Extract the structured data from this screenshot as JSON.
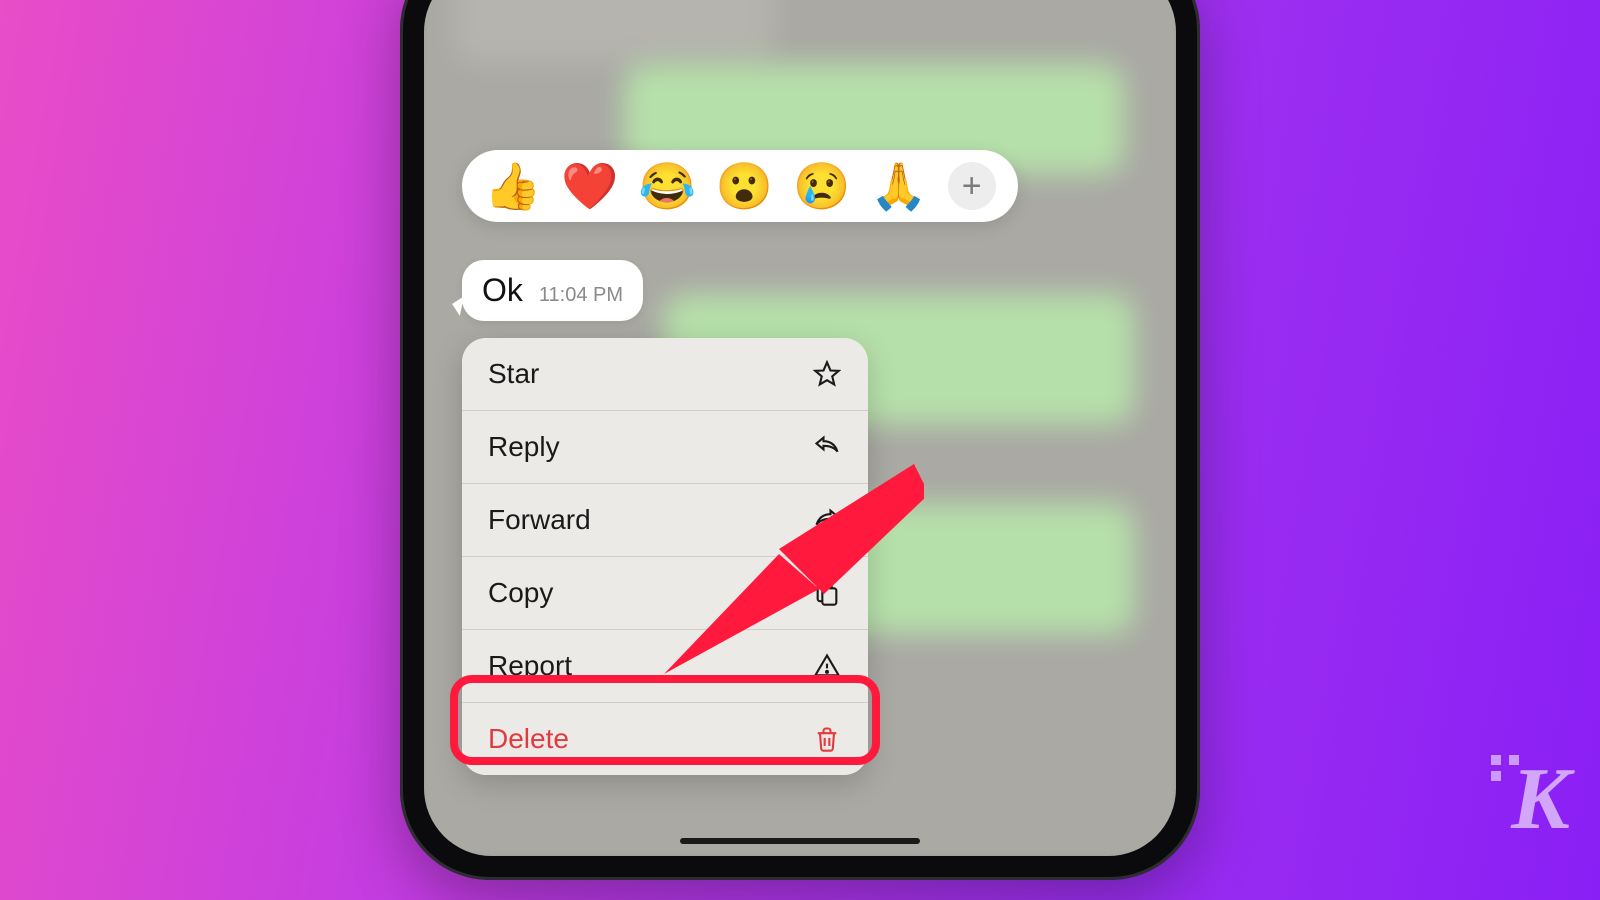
{
  "message": {
    "text": "Ok",
    "time": "11:04 PM"
  },
  "reactions": {
    "items": [
      "👍",
      "❤️",
      "😂",
      "😮",
      "😢",
      "🙏"
    ],
    "add_label": "+"
  },
  "menu": {
    "items": [
      {
        "label": "Star",
        "icon": "star-icon"
      },
      {
        "label": "Reply",
        "icon": "reply-icon"
      },
      {
        "label": "Forward",
        "icon": "forward-icon"
      },
      {
        "label": "Copy",
        "icon": "copy-icon"
      },
      {
        "label": "Report",
        "icon": "warning-icon"
      },
      {
        "label": "Delete",
        "icon": "trash-icon"
      }
    ]
  },
  "watermark": "K",
  "annotation": {
    "arrow_color": "#ff1a3d",
    "highlight_color": "#ff1a3d"
  }
}
